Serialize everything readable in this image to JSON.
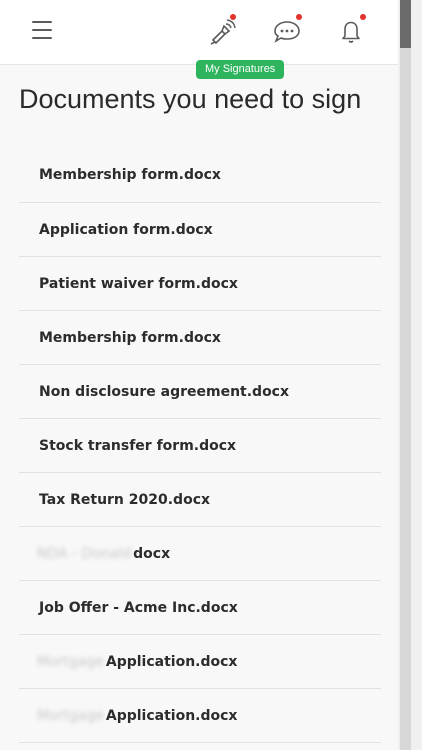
{
  "header": {
    "menu_icon": "hamburger-menu-icon",
    "icons": [
      "signature-pen-icon",
      "chat-bubble-icon",
      "bell-icon"
    ],
    "notification_color": "#e0322b",
    "badge_label": "My Signatures",
    "badge_color": "#2db45d"
  },
  "page": {
    "title": "Documents you need to sign"
  },
  "documents": [
    {
      "prefix": "",
      "name": "Membership form.docx"
    },
    {
      "prefix": "",
      "name": "Application form.docx"
    },
    {
      "prefix": "",
      "name": "Patient waiver form.docx"
    },
    {
      "prefix": "",
      "name": "Membership form.docx"
    },
    {
      "prefix": "",
      "name": "Non disclosure agreement.docx"
    },
    {
      "prefix": "",
      "name": "Stock transfer form.docx"
    },
    {
      "prefix": "",
      "name": "Tax Return 2020.docx"
    },
    {
      "prefix": "NDA - Donald",
      "name": "docx"
    },
    {
      "prefix": "",
      "name": "Job Offer - Acme Inc.docx"
    },
    {
      "prefix": "Mortgage",
      "name": "Application.docx"
    },
    {
      "prefix": "Mortgage",
      "name": "Application.docx"
    }
  ]
}
